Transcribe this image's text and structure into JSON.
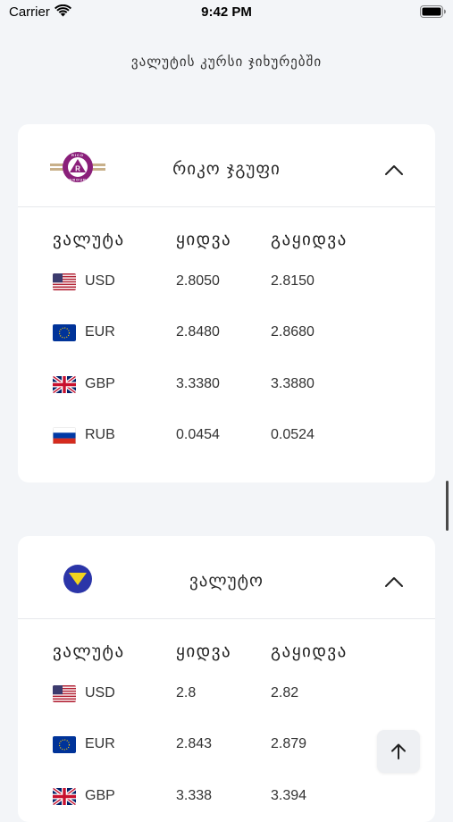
{
  "status_bar": {
    "carrier": "Carrier",
    "time": "9:42 PM"
  },
  "page": {
    "title": "ვალუტის კურსი ჯიხურებში"
  },
  "colors": {
    "background": "#f3f5f8",
    "card": "#ffffff",
    "rico_purple": "#8a1f7a",
    "valuto_blue": "#2b35a8",
    "valuto_yellow": "#f2d41e"
  },
  "cards": [
    {
      "title": "რიკო ჯგუფი",
      "logo": "rico-group-logo",
      "logo_text": "RICO GROUP",
      "columns": [
        "ვალუტა",
        "ყიდვა",
        "გაყიდვა"
      ],
      "rows": [
        {
          "flag": "us-flag-icon",
          "code": "USD",
          "buy": "2.8050",
          "sell": "2.8150"
        },
        {
          "flag": "eu-flag-icon",
          "code": "EUR",
          "buy": "2.8480",
          "sell": "2.8680"
        },
        {
          "flag": "gb-flag-icon",
          "code": "GBP",
          "buy": "3.3380",
          "sell": "3.3880"
        },
        {
          "flag": "ru-flag-icon",
          "code": "RUB",
          "buy": "0.0454",
          "sell": "0.0524"
        }
      ]
    },
    {
      "title": "ვალუტო",
      "logo": "valuto-logo",
      "columns": [
        "ვალუტა",
        "ყიდვა",
        "გაყიდვა"
      ],
      "rows": [
        {
          "flag": "us-flag-icon",
          "code": "USD",
          "buy": "2.8",
          "sell": "2.82"
        },
        {
          "flag": "eu-flag-icon",
          "code": "EUR",
          "buy": "2.843",
          "sell": "2.879"
        },
        {
          "flag": "gb-flag-icon",
          "code": "GBP",
          "buy": "3.338",
          "sell": "3.394"
        }
      ]
    }
  ]
}
